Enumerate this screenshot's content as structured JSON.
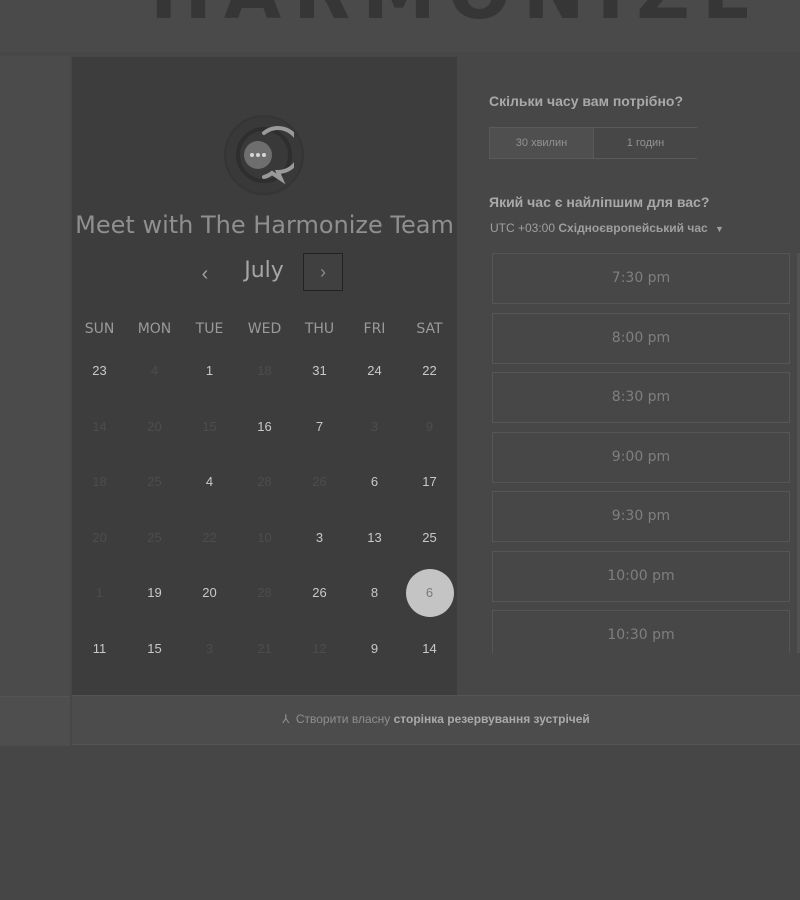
{
  "brand": {
    "logo_text": "HARMONIZE"
  },
  "calendar": {
    "title": "Meet with The Harmonize Team",
    "month": "July",
    "prev_icon": "chevron-left-icon",
    "next_icon": "chevron-right-icon",
    "prev_glyph": "‹",
    "next_glyph": "›",
    "weekdays": [
      "SUN",
      "MON",
      "TUE",
      "WED",
      "THU",
      "FRI",
      "SAT"
    ],
    "weeks": [
      [
        {
          "d": "23",
          "on": true
        },
        {
          "d": "4",
          "on": false
        },
        {
          "d": "1",
          "on": true
        },
        {
          "d": "18",
          "on": false
        },
        {
          "d": "31",
          "on": true
        },
        {
          "d": "24",
          "on": true
        },
        {
          "d": "22",
          "on": true
        }
      ],
      [
        {
          "d": "14",
          "on": false
        },
        {
          "d": "20",
          "on": false
        },
        {
          "d": "15",
          "on": false
        },
        {
          "d": "16",
          "on": true
        },
        {
          "d": "7",
          "on": true
        },
        {
          "d": "3",
          "on": false
        },
        {
          "d": "9",
          "on": false
        }
      ],
      [
        {
          "d": "18",
          "on": false
        },
        {
          "d": "25",
          "on": false
        },
        {
          "d": "4",
          "on": true
        },
        {
          "d": "28",
          "on": false
        },
        {
          "d": "26",
          "on": false
        },
        {
          "d": "6",
          "on": true
        },
        {
          "d": "17",
          "on": true
        }
      ],
      [
        {
          "d": "20",
          "on": false
        },
        {
          "d": "25",
          "on": false
        },
        {
          "d": "22",
          "on": false
        },
        {
          "d": "10",
          "on": false
        },
        {
          "d": "3",
          "on": true
        },
        {
          "d": "13",
          "on": true
        },
        {
          "d": "25",
          "on": true
        }
      ],
      [
        {
          "d": "1",
          "on": false
        },
        {
          "d": "19",
          "on": true
        },
        {
          "d": "20",
          "on": true
        },
        {
          "d": "28",
          "on": false
        },
        {
          "d": "26",
          "on": true
        },
        {
          "d": "8",
          "on": true
        },
        {
          "d": "6",
          "on": true,
          "selected": true
        }
      ],
      [
        {
          "d": "11",
          "on": true
        },
        {
          "d": "15",
          "on": true
        },
        {
          "d": "3",
          "on": false
        },
        {
          "d": "21",
          "on": false
        },
        {
          "d": "12",
          "on": false
        },
        {
          "d": "9",
          "on": true
        },
        {
          "d": "14",
          "on": true
        }
      ]
    ]
  },
  "duration": {
    "question": "Скільки часу вам потрібно?",
    "options": [
      "30 хвилин",
      "1 годин"
    ],
    "selected": "30 хвилин"
  },
  "time": {
    "question": "Який час є найліпшим для вас?",
    "tz_offset": "UTC +03:00",
    "tz_name": "Східноєвропейський час",
    "tz_caret": "▼",
    "slots": [
      "7:30 pm",
      "8:00 pm",
      "8:30 pm",
      "9:00 pm",
      "9:30 pm",
      "10:00 pm",
      "10:30 pm"
    ]
  },
  "footer": {
    "icon": "sprocket-icon",
    "icon_glyph": "⅄",
    "prefix": "Створити власну",
    "link_text": "сторінка резервування зустрічей"
  },
  "colors": {
    "panel": "#3d3d3d",
    "background": "#474747",
    "selected_day": "#c4c4c4"
  }
}
